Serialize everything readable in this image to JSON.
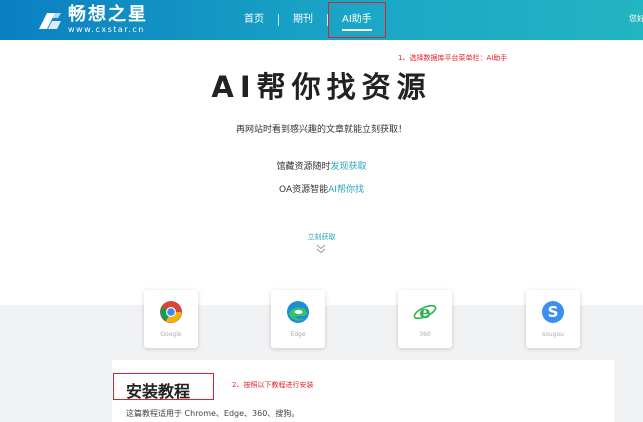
{
  "header": {
    "logo": {
      "name": "畅想之星",
      "domain": "www.cxstar.cn"
    },
    "nav": [
      {
        "label": "首页"
      },
      {
        "label": "期刊"
      },
      {
        "label": "AI助手",
        "active": true
      }
    ],
    "right_text": "您好",
    "colors": {
      "gradient_start": "#0a7fc1",
      "gradient_end": "#23b4c2"
    }
  },
  "annotations": {
    "step1": "1、选择数据库平台菜单栏：AI助手",
    "step2": "2、按照以下教程进行安装"
  },
  "hero": {
    "title": "AI帮你找资源",
    "subtitle": "再网站时看到感兴趣的文章就能立刻获取！",
    "feature1": {
      "prefix": "馆藏资源随时",
      "link": "发现获取"
    },
    "feature2": {
      "prefix": "OA资源智能",
      "link": "AI帮你找"
    },
    "cta": "立刻获取"
  },
  "browsers": [
    {
      "name": "Google",
      "icon": "chrome-icon"
    },
    {
      "name": "Edge",
      "icon": "edge-icon"
    },
    {
      "name": "360",
      "icon": "ie-360-icon"
    },
    {
      "name": "sougou",
      "icon": "sogou-icon"
    }
  ],
  "install": {
    "title": "安装教程",
    "description": "这篇教程适用于 Chrome、Edge、360、搜狗。"
  },
  "accent_color": "#2aa7b8",
  "annotation_color": "#e0222a"
}
